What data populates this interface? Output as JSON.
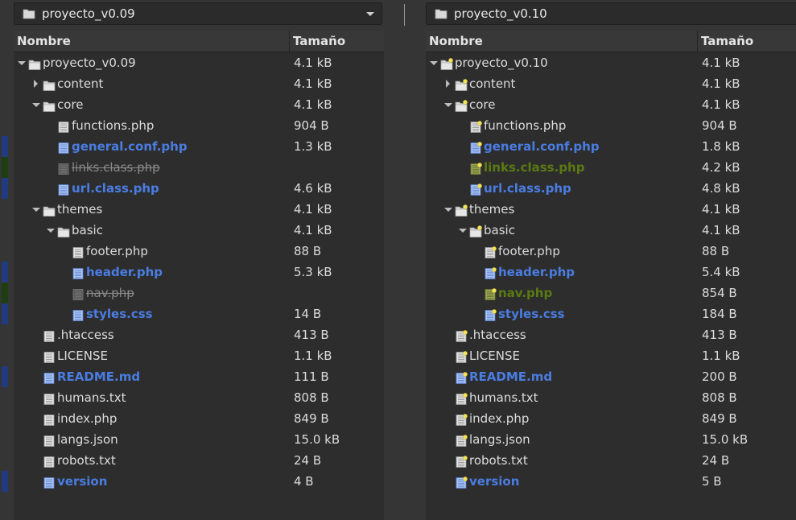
{
  "left": {
    "path": "proyecto_v0.09",
    "columns": {
      "name": "Nombre",
      "size": "Tamaño"
    },
    "rows": [
      {
        "name": "proyecto_v0.09",
        "size": "4.1 kB",
        "type": "folder",
        "depth": 0,
        "expander": "open",
        "status": "normal"
      },
      {
        "name": "content",
        "size": "4.1 kB",
        "type": "folder",
        "depth": 1,
        "expander": "closed",
        "status": "normal"
      },
      {
        "name": "core",
        "size": "4.1 kB",
        "type": "folder",
        "depth": 1,
        "expander": "open",
        "status": "normal"
      },
      {
        "name": "functions.php",
        "size": "904 B",
        "type": "file",
        "depth": 2,
        "status": "normal"
      },
      {
        "name": "general.conf.php",
        "size": "1.3 kB",
        "type": "file",
        "depth": 2,
        "status": "changed"
      },
      {
        "name": "links.class.php",
        "size": "",
        "type": "file",
        "depth": 2,
        "status": "missing"
      },
      {
        "name": "url.class.php",
        "size": "4.6 kB",
        "type": "file",
        "depth": 2,
        "status": "changed"
      },
      {
        "name": "themes",
        "size": "4.1 kB",
        "type": "folder",
        "depth": 1,
        "expander": "open",
        "status": "normal"
      },
      {
        "name": "basic",
        "size": "4.1 kB",
        "type": "folder",
        "depth": 2,
        "expander": "open",
        "status": "normal"
      },
      {
        "name": "footer.php",
        "size": "88 B",
        "type": "file",
        "depth": 3,
        "status": "normal"
      },
      {
        "name": "header.php",
        "size": "5.3 kB",
        "type": "file",
        "depth": 3,
        "status": "changed"
      },
      {
        "name": "nav.php",
        "size": "",
        "type": "file",
        "depth": 3,
        "status": "missing"
      },
      {
        "name": "styles.css",
        "size": "14 B",
        "type": "file",
        "depth": 3,
        "status": "changed"
      },
      {
        "name": ".htaccess",
        "size": "413 B",
        "type": "file",
        "depth": 1,
        "status": "normal"
      },
      {
        "name": "LICENSE",
        "size": "1.1 kB",
        "type": "file",
        "depth": 1,
        "status": "normal"
      },
      {
        "name": "README.md",
        "size": "111 B",
        "type": "file",
        "depth": 1,
        "status": "changed"
      },
      {
        "name": "humans.txt",
        "size": "808 B",
        "type": "file",
        "depth": 1,
        "status": "normal"
      },
      {
        "name": "index.php",
        "size": "849 B",
        "type": "file",
        "depth": 1,
        "status": "normal"
      },
      {
        "name": "langs.json",
        "size": "15.0 kB",
        "type": "file",
        "depth": 1,
        "status": "normal"
      },
      {
        "name": "robots.txt",
        "size": "24 B",
        "type": "file",
        "depth": 1,
        "status": "normal"
      },
      {
        "name": "version",
        "size": "4 B",
        "type": "file",
        "depth": 1,
        "status": "changed"
      }
    ]
  },
  "right": {
    "path": "proyecto_v0.10",
    "columns": {
      "name": "Nombre",
      "size": "Tamaño"
    },
    "rows": [
      {
        "name": "proyecto_v0.10",
        "size": "4.1 kB",
        "type": "folder",
        "depth": 0,
        "expander": "open",
        "status": "normal"
      },
      {
        "name": "content",
        "size": "4.1 kB",
        "type": "folder",
        "depth": 1,
        "expander": "closed",
        "status": "normal"
      },
      {
        "name": "core",
        "size": "4.1 kB",
        "type": "folder",
        "depth": 1,
        "expander": "open",
        "status": "normal"
      },
      {
        "name": "functions.php",
        "size": "904 B",
        "type": "file",
        "depth": 2,
        "status": "normal"
      },
      {
        "name": "general.conf.php",
        "size": "1.8 kB",
        "type": "file",
        "depth": 2,
        "status": "changed"
      },
      {
        "name": "links.class.php",
        "size": "4.2 kB",
        "type": "file",
        "depth": 2,
        "status": "added"
      },
      {
        "name": "url.class.php",
        "size": "4.8 kB",
        "type": "file",
        "depth": 2,
        "status": "changed"
      },
      {
        "name": "themes",
        "size": "4.1 kB",
        "type": "folder",
        "depth": 1,
        "expander": "open",
        "status": "normal"
      },
      {
        "name": "basic",
        "size": "4.1 kB",
        "type": "folder",
        "depth": 2,
        "expander": "open",
        "status": "normal"
      },
      {
        "name": "footer.php",
        "size": "88 B",
        "type": "file",
        "depth": 3,
        "status": "normal"
      },
      {
        "name": "header.php",
        "size": "5.4 kB",
        "type": "file",
        "depth": 3,
        "status": "changed"
      },
      {
        "name": "nav.php",
        "size": "854 B",
        "type": "file",
        "depth": 3,
        "status": "added"
      },
      {
        "name": "styles.css",
        "size": "184 B",
        "type": "file",
        "depth": 3,
        "status": "changed"
      },
      {
        "name": ".htaccess",
        "size": "413 B",
        "type": "file",
        "depth": 1,
        "status": "normal"
      },
      {
        "name": "LICENSE",
        "size": "1.1 kB",
        "type": "file",
        "depth": 1,
        "status": "normal"
      },
      {
        "name": "README.md",
        "size": "200 B",
        "type": "file",
        "depth": 1,
        "status": "changed"
      },
      {
        "name": "humans.txt",
        "size": "808 B",
        "type": "file",
        "depth": 1,
        "status": "normal"
      },
      {
        "name": "index.php",
        "size": "849 B",
        "type": "file",
        "depth": 1,
        "status": "normal"
      },
      {
        "name": "langs.json",
        "size": "15.0 kB",
        "type": "file",
        "depth": 1,
        "status": "normal"
      },
      {
        "name": "robots.txt",
        "size": "24 B",
        "type": "file",
        "depth": 1,
        "status": "normal"
      },
      {
        "name": "version",
        "size": "5 B",
        "type": "file",
        "depth": 1,
        "status": "changed"
      }
    ]
  },
  "colors": {
    "changed": "#4a7de2",
    "added": "#5b7a12",
    "missing": "#8a8a8a",
    "gutter_changed": "#213a80",
    "gutter_added": "#1e3e12"
  },
  "icons": {
    "folder": "folder-icon",
    "file": "text-file-icon",
    "dropdown": "chevron-down-icon",
    "expander_open": "expander-open-icon",
    "expander_closed": "expander-closed-icon",
    "emblem": "emblem-new-icon"
  }
}
